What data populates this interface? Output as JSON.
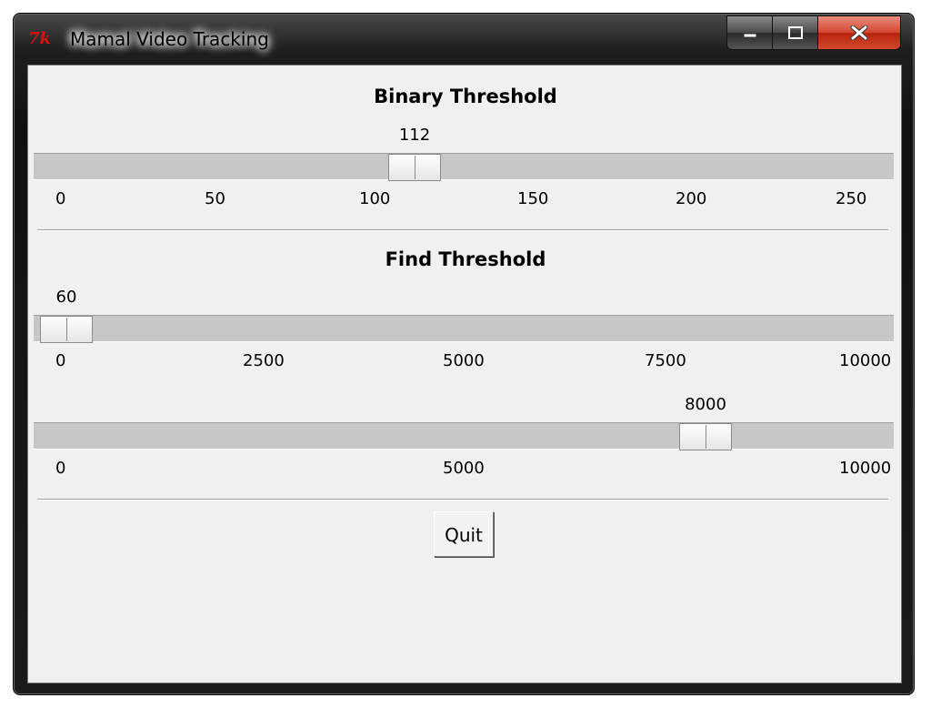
{
  "window": {
    "title": "Mamal Video Tracking",
    "icon": "tk-feather-icon",
    "caption_buttons": [
      "minimize",
      "maximize",
      "close"
    ]
  },
  "binary_threshold": {
    "title": "Binary Threshold",
    "value": "112",
    "min": 0,
    "max": 255,
    "ticks": [
      "0",
      "50",
      "100",
      "150",
      "200",
      "250"
    ]
  },
  "find_threshold": {
    "title": "Find Threshold",
    "slider1": {
      "value": "60",
      "min": 0,
      "max": 10000,
      "ticks": [
        "0",
        "2500",
        "5000",
        "7500",
        "10000"
      ]
    },
    "slider2": {
      "value": "8000",
      "min": 0,
      "max": 10000,
      "ticks": [
        "0",
        "5000",
        "10000"
      ]
    }
  },
  "quit_label": "Quit",
  "colors": {
    "client_background": "#f0f0f0",
    "trough": "#c7c7c7",
    "close_button": "#d2462f",
    "icon_red": "#e01010"
  }
}
